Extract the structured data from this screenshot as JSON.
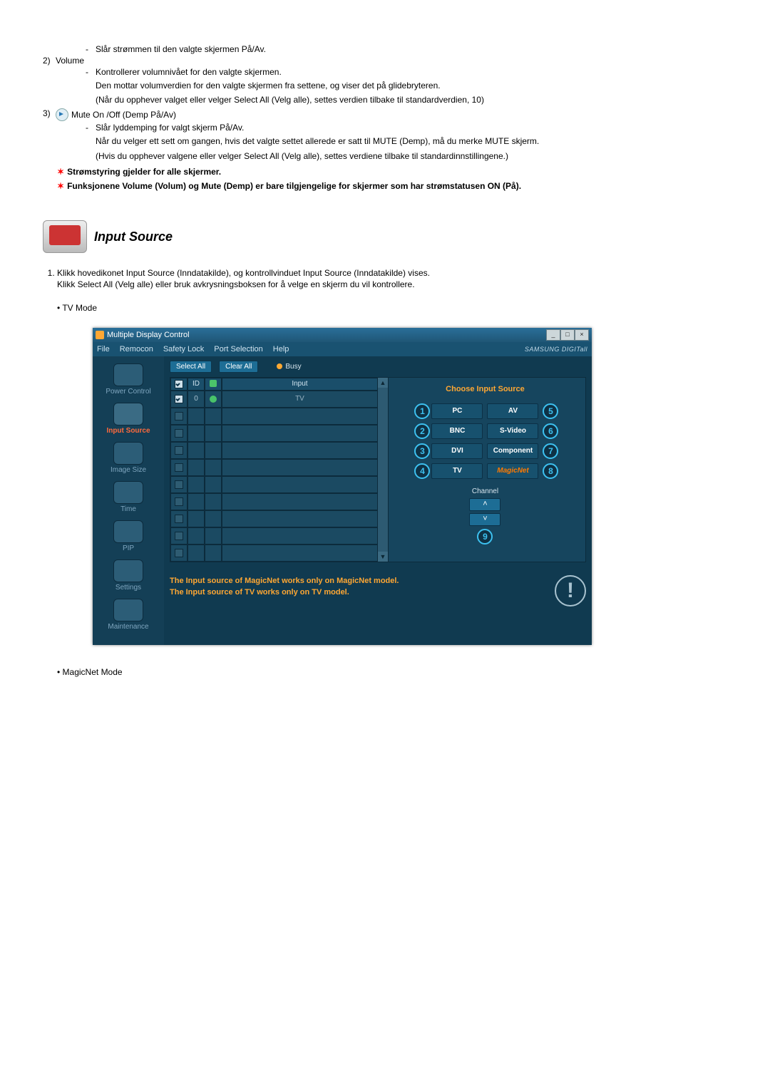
{
  "power_off_note": "Slår strømmen til den valgte skjermen På/Av.",
  "volume": {
    "num": "2)",
    "title": "Volume",
    "l1": "Kontrollerer volumnivået for den valgte skjermen.",
    "l2": "Den mottar volumverdien for den valgte skjermen fra settene, og viser det på glidebryteren.",
    "l3": "(Når du opphever valget eller velger Select All (Velg alle), settes verdien tilbake til standardverdien, 10)"
  },
  "mute": {
    "num": "3)",
    "title": "Mute On /Off (Demp På/Av)",
    "l1": "Slår lyddemping for valgt skjerm På/Av.",
    "l2": "Når du velger ett sett om gangen, hvis det valgte settet allerede er satt til MUTE (Demp), må du merke MUTE skjerm.",
    "l3": "(Hvis du opphever valgene eller velger Select All (Velg alle), settes verdiene tilbake til standardinnstillingene.)"
  },
  "star1": "Strømstyring gjelder for alle skjermer.",
  "star2": "Funksjonene Volume (Volum) og Mute (Demp) er bare tilgjengelige for skjermer som har strømstatusen ON (På).",
  "section": {
    "title": "Input Source",
    "step1a": "Klikk hovedikonet Input Source (Inndatakilde), og kontrollvinduet Input Source (Inndatakilde) vises.",
    "step1b": "Klikk Select All (Velg alle) eller bruk avkrysningsboksen for å velge en skjerm du vil kontrollere.",
    "tvmode": "TV Mode",
    "magicnet": "MagicNet Mode"
  },
  "app": {
    "title": "Multiple Display Control",
    "menu": {
      "file": "File",
      "remocon": "Remocon",
      "safety": "Safety Lock",
      "port": "Port Selection",
      "help": "Help"
    },
    "brand": "SAMSUNG DIGITall",
    "toolbar": {
      "select_all": "Select All",
      "clear_all": "Clear All",
      "busy": "Busy"
    },
    "sidebar": {
      "power": "Power Control",
      "input": "Input Source",
      "image": "Image Size",
      "time": "Time",
      "pip": "PIP",
      "settings": "Settings",
      "maintenance": "Maintenance"
    },
    "grid": {
      "col_id": "ID",
      "col_input": "Input",
      "first_id": "0",
      "first_input": "TV"
    },
    "panel": {
      "title": "Choose Input Source",
      "pc": "PC",
      "av": "AV",
      "bnc": "BNC",
      "svideo": "S-Video",
      "dvi": "DVI",
      "component": "Component",
      "tv": "TV",
      "magicnet": "MagicNet",
      "n1": "1",
      "n2": "2",
      "n3": "3",
      "n4": "4",
      "n5": "5",
      "n6": "6",
      "n7": "7",
      "n8": "8",
      "n9": "9",
      "channel": "Channel"
    },
    "footer1": "The Input source of MagicNet works only on MagicNet model.",
    "footer2": "The Input source of TV works only on TV  model."
  }
}
